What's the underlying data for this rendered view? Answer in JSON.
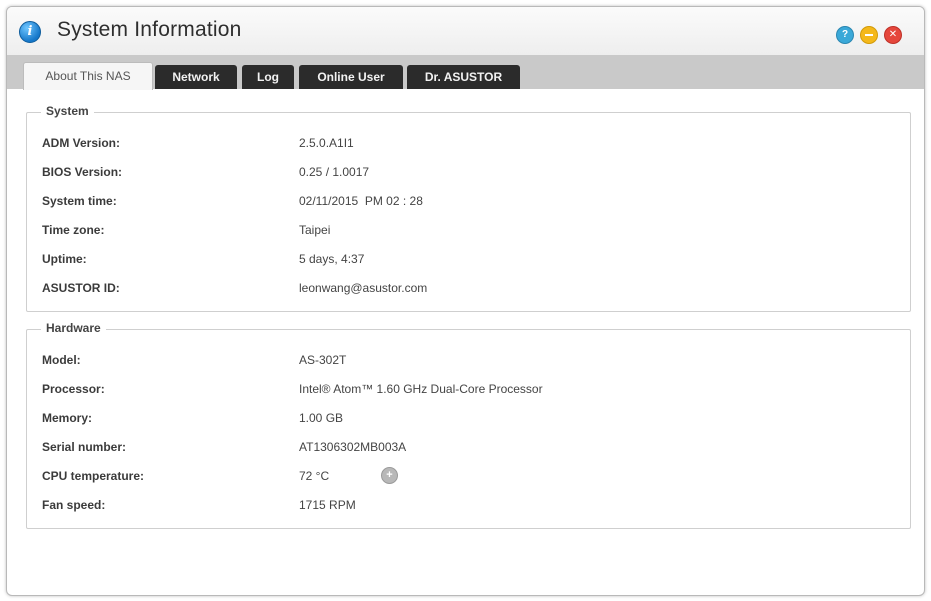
{
  "window": {
    "title": "System Information",
    "app_icon": "i"
  },
  "tabs": [
    {
      "label": "About This NAS",
      "active": true
    },
    {
      "label": "Network",
      "active": false
    },
    {
      "label": "Log",
      "active": false
    },
    {
      "label": "Online User",
      "active": false
    },
    {
      "label": "Dr. ASUSTOR",
      "active": false
    }
  ],
  "system": {
    "title": "System",
    "rows": [
      {
        "label": "ADM Version:",
        "value": "2.5.0.A1I1"
      },
      {
        "label": "BIOS Version:",
        "value": "0.25 / 1.0017"
      },
      {
        "label": "System time:",
        "value": "02/11/2015  PM 02 : 28"
      },
      {
        "label": "Time zone:",
        "value": "Taipei"
      },
      {
        "label": "Uptime:",
        "value": "5 days, 4:37"
      },
      {
        "label": "ASUSTOR ID:",
        "value": "leonwang@asustor.com"
      }
    ]
  },
  "hardware": {
    "title": "Hardware",
    "rows": [
      {
        "label": "Model:",
        "value": "AS-302T"
      },
      {
        "label": "Processor:",
        "value": "Intel® Atom™ 1.60 GHz Dual-Core Processor"
      },
      {
        "label": "Memory:",
        "value": "1.00 GB"
      },
      {
        "label": "Serial number:",
        "value": "AT1306302MB003A"
      },
      {
        "label": "CPU temperature:",
        "value": "72 °C"
      },
      {
        "label": "Fan speed:",
        "value": "1715 RPM"
      }
    ]
  },
  "icons": {
    "help": "help-icon",
    "minimize": "minimize-icon",
    "close": "close-icon",
    "cpu_temp_info": "plus-circle-icon"
  },
  "colors": {
    "help": "#3aa8d8",
    "minimize": "#f4b81a",
    "close": "#e5473c",
    "tab_dark": "#2b2b2b"
  }
}
